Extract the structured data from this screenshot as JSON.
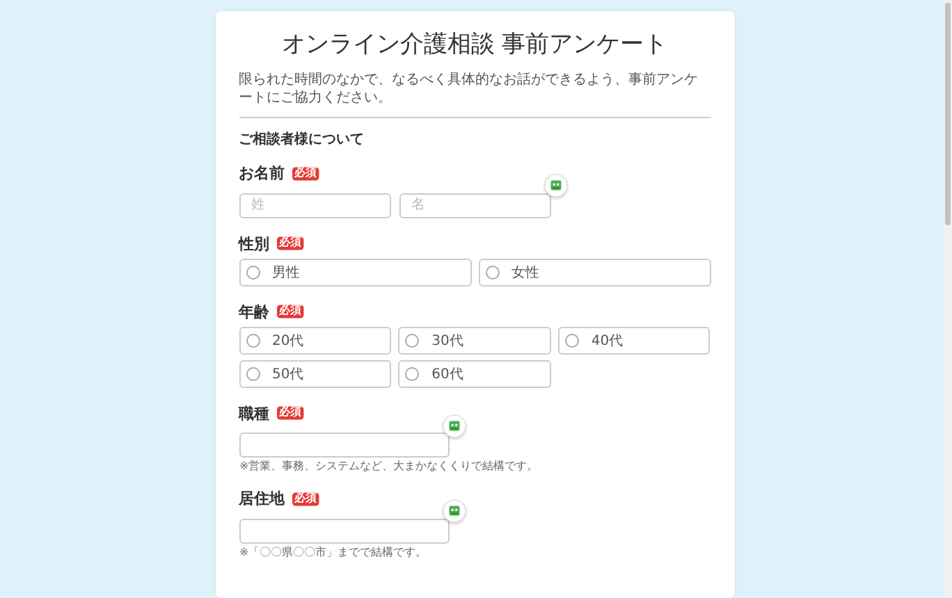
{
  "form": {
    "title": "オンライン介護相談 事前アンケート",
    "intro": "限られた時間のなかで、なるべく具体的なお話ができるよう、事前アンケートにご協力ください。",
    "section_heading": "ご相談者様について",
    "fields": [
      {
        "kind": "name",
        "label": "お名前",
        "badge": "必須",
        "helper_icon": true,
        "inputs": [
          {
            "placeholder": "姓"
          },
          {
            "placeholder": "名"
          }
        ]
      },
      {
        "kind": "choice",
        "label": "性別",
        "badge": "必須",
        "options": [
          {
            "label": "男性",
            "selected": false
          },
          {
            "label": "女性",
            "selected": false
          }
        ]
      },
      {
        "kind": "choice",
        "label": "年齢",
        "badge": "必須",
        "options": [
          {
            "label": "20代",
            "selected": false
          },
          {
            "label": "30代",
            "selected": false
          },
          {
            "label": "40代",
            "selected": false
          },
          {
            "label": "50代",
            "selected": false
          },
          {
            "label": "60代",
            "selected": false
          }
        ]
      },
      {
        "kind": "text",
        "label": "職種",
        "badge": "必須",
        "helper_icon": true,
        "hint": "※営業、事務、システムなど、大まかなくくりで結構です。"
      },
      {
        "kind": "text",
        "label": "居住地",
        "badge": "必須",
        "helper_icon": true,
        "hint": "※「〇〇県〇〇市」までで結構です。"
      }
    ]
  }
}
